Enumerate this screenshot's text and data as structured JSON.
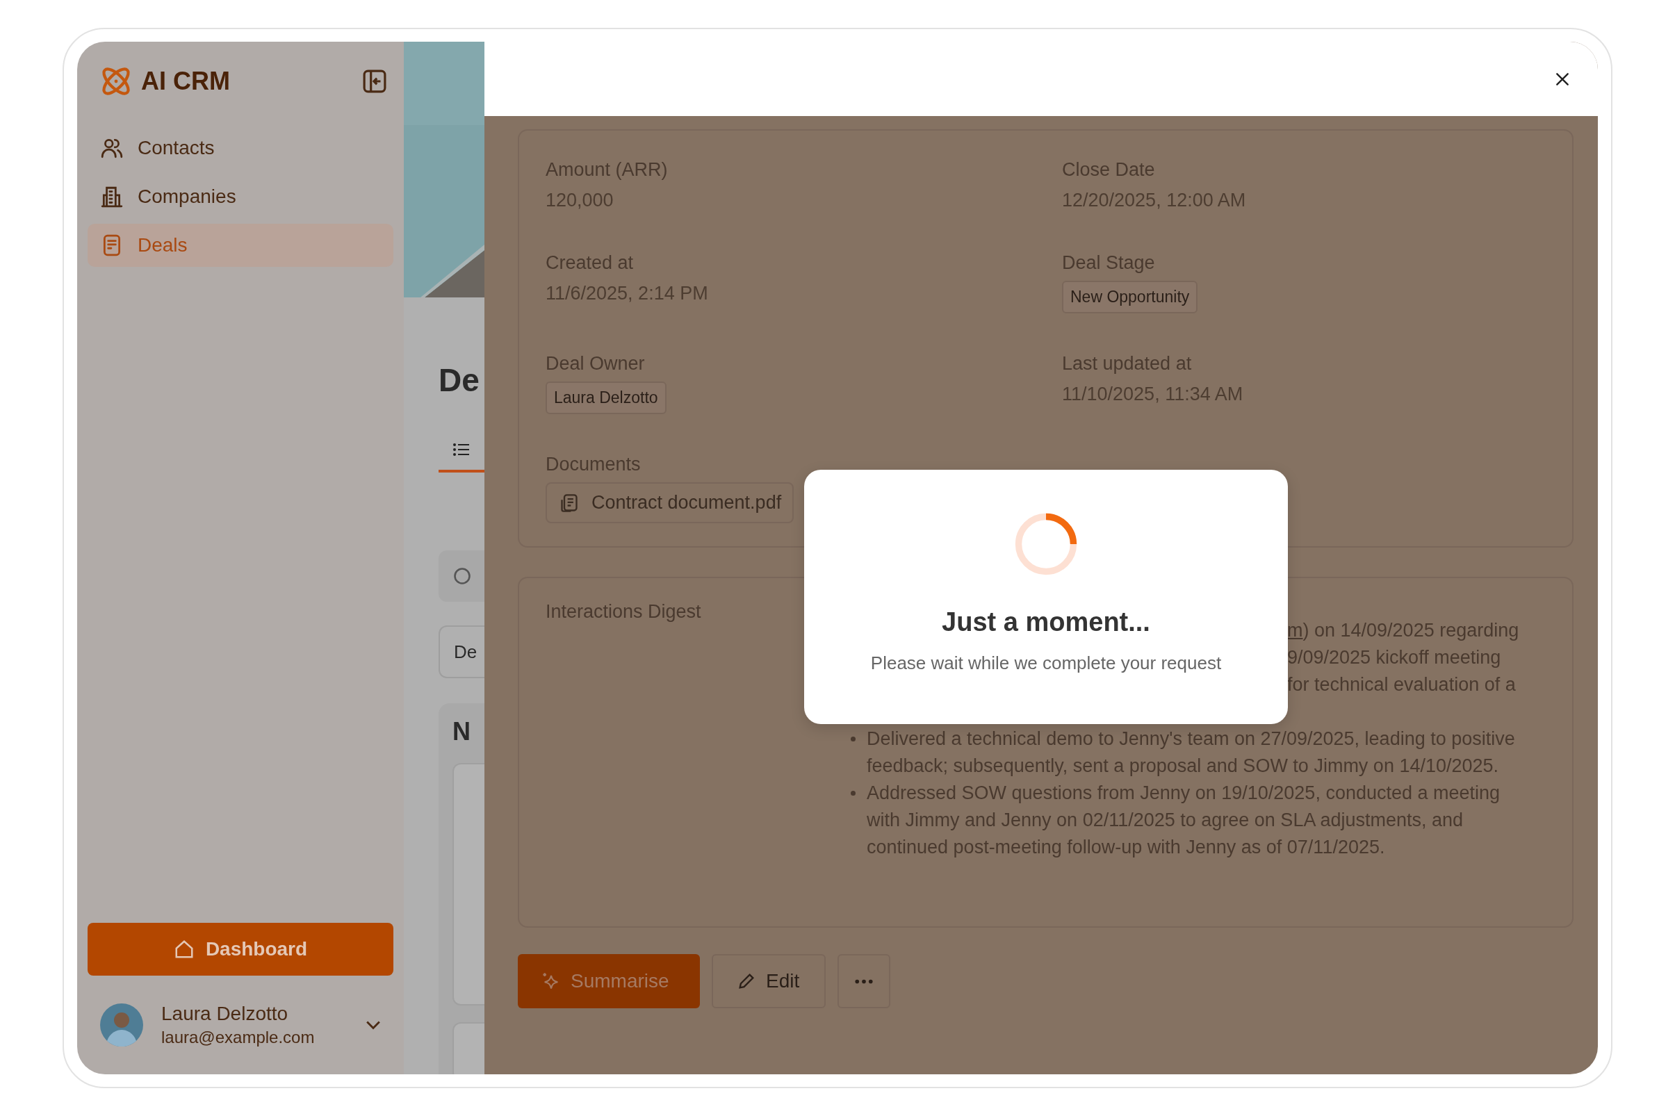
{
  "sidebar": {
    "logo": "AI CRM",
    "nav": [
      {
        "label": "Contacts",
        "selected": false
      },
      {
        "label": "Companies",
        "selected": false
      },
      {
        "label": "Deals",
        "selected": true
      }
    ],
    "dashboard_button": "Dashboard",
    "user": {
      "name": "Laura Delzotto",
      "email": "laura@example.com"
    }
  },
  "background_page": {
    "heading": "De",
    "filter": "De",
    "card_heading": "N"
  },
  "panel": {
    "fields": [
      {
        "label": "Amount (ARR)",
        "value": "120,000",
        "kind": "text"
      },
      {
        "label": "Close Date",
        "value": "12/20/2025, 12:00 AM",
        "kind": "text"
      },
      {
        "label": "Created at",
        "value": "11/6/2025, 2:14 PM",
        "kind": "text"
      },
      {
        "label": "Deal Stage",
        "value": "New Opportunity",
        "kind": "tag"
      },
      {
        "label": "Deal Owner",
        "value": "Laura Delzotto",
        "kind": "tag"
      },
      {
        "label": "Last updated at",
        "value": "11/10/2025, 11:34 AM",
        "kind": "text"
      }
    ],
    "documents": {
      "label": "Documents",
      "file": "Contract document.pdf"
    },
    "digest": {
      "label": "Interactions Digest",
      "first_bullet_fragments": [
        {
          "link": "m",
          "text": ") on 14/09/2025 regarding"
        },
        {
          "text": "9/09/2025 kickoff meeting"
        },
        {
          "text": "for technical evaluation of a"
        }
      ],
      "bullets": [
        "Delivered a technical demo to Jenny's team on 27/09/2025, leading to positive feedback; subsequently, sent a proposal and SOW to Jimmy on 14/10/2025.",
        "Addressed SOW questions from Jenny on 19/10/2025, conducted a meeting with Jimmy and Jenny on 02/11/2025 to agree on SLA adjustments, and continued post-meeting follow-up with Jenny as of 07/11/2025."
      ]
    },
    "actions": [
      {
        "label": "Summarise",
        "kind": "primary"
      },
      {
        "label": "Edit",
        "kind": "secondary"
      },
      {
        "kind": "more"
      }
    ]
  },
  "modal": {
    "title": "Just a moment...",
    "message": "Please wait while we complete your request"
  }
}
